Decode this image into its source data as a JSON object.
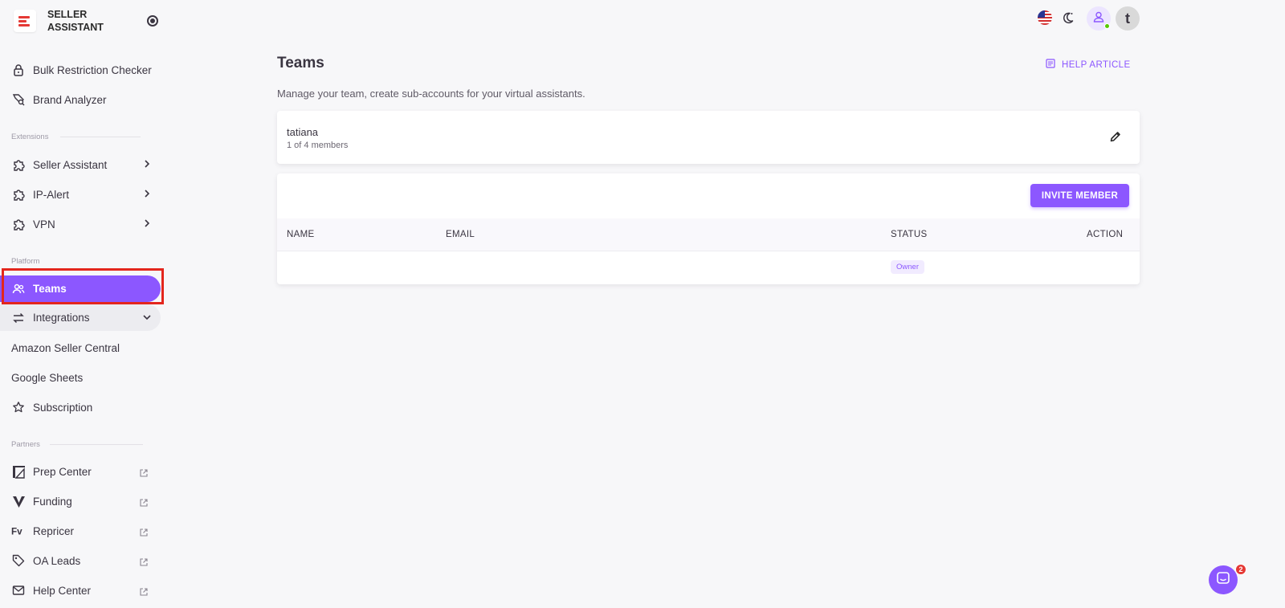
{
  "brand": {
    "title": "SELLER ASSISTANT"
  },
  "sidebar": {
    "tools": [
      {
        "label": "Bulk Restriction Checker",
        "icon": "lock-icon"
      },
      {
        "label": "Brand Analyzer",
        "icon": "search-tag-icon"
      }
    ],
    "sections": {
      "extensions": "Extensions",
      "platform": "Platform",
      "partners": "Partners"
    },
    "extensions": [
      {
        "label": "Seller Assistant",
        "icon": "puzzle-icon"
      },
      {
        "label": "IP-Alert",
        "icon": "puzzle-icon"
      },
      {
        "label": "VPN",
        "icon": "puzzle-icon"
      }
    ],
    "platform": {
      "teams": "Teams",
      "integrations": "Integrations",
      "integration_items": [
        "Amazon Seller Central",
        "Google Sheets"
      ],
      "subscription": "Subscription"
    },
    "partners": [
      {
        "label": "Prep Center",
        "icon": "prep-center-icon"
      },
      {
        "label": "Funding",
        "icon": "funding-logo-icon"
      },
      {
        "label": "Repricer",
        "icon": "repricer-logo-icon"
      },
      {
        "label": "OA Leads",
        "icon": "tag-icon"
      },
      {
        "label": "Help Center",
        "icon": "mail-icon"
      }
    ]
  },
  "page": {
    "title": "Teams",
    "help_article": "HELP ARTICLE",
    "subtitle": "Manage your team, create sub-accounts for your virtual assistants."
  },
  "team": {
    "name": "tatiana",
    "members": "1 of 4 members"
  },
  "members_table": {
    "invite_label": "INVITE MEMBER",
    "columns": [
      "NAME",
      "EMAIL",
      "STATUS",
      "ACTION"
    ],
    "rows": [
      {
        "name": "",
        "email": "",
        "status": "Owner",
        "action": ""
      }
    ]
  },
  "topbar": {
    "avatar_initial": "t"
  },
  "chat": {
    "unread": "2"
  },
  "colors": {
    "accent": "#8c57ff",
    "brand_red": "#e53935",
    "highlight": "#e3261d"
  }
}
